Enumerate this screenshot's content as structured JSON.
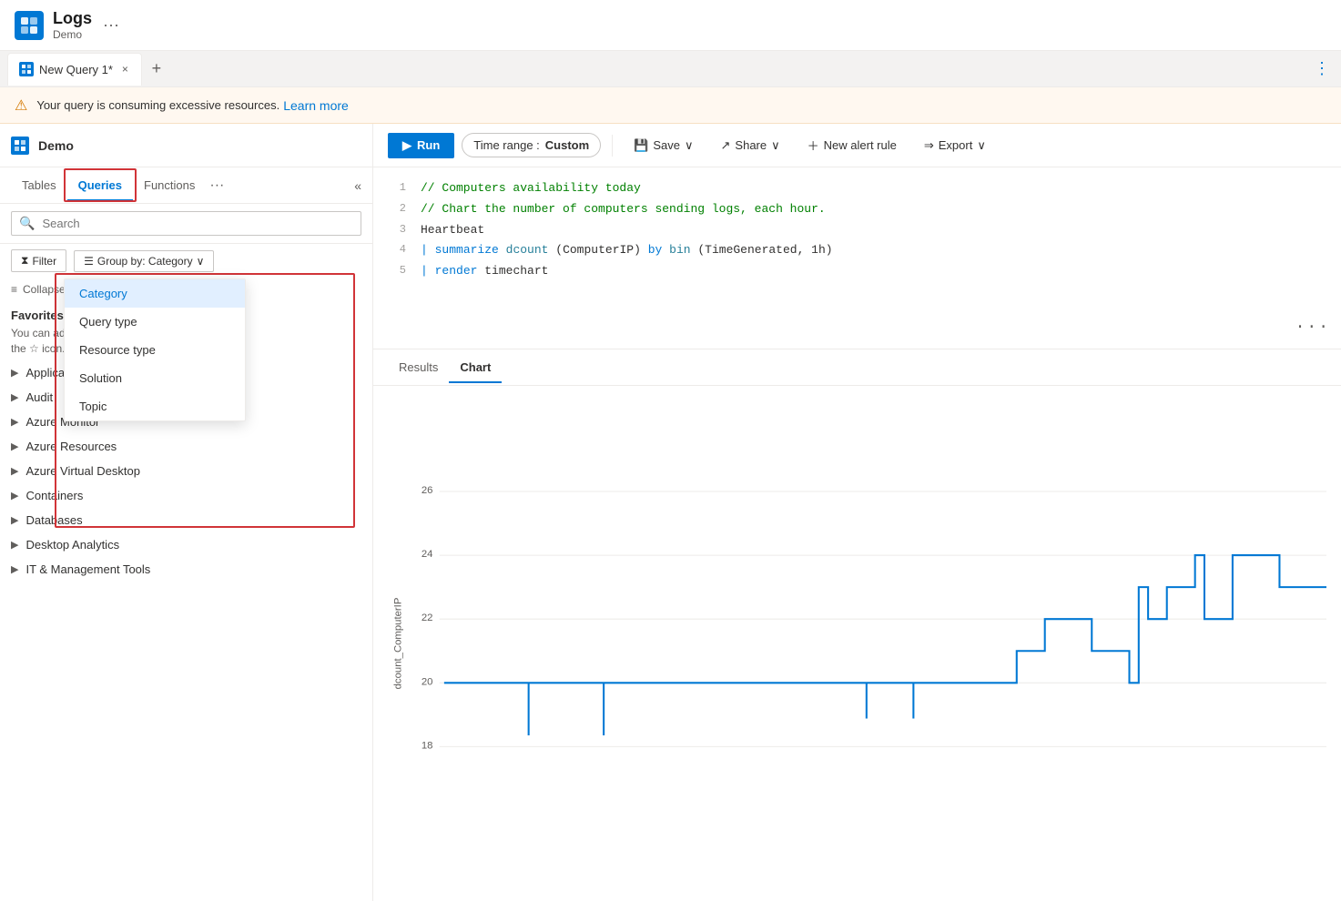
{
  "app": {
    "title": "Logs",
    "subtitle": "Demo",
    "ellipsis": "···"
  },
  "tab_bar": {
    "tab_icon": "logs-icon",
    "tab_label": "New Query 1*",
    "tab_close": "×",
    "tab_add": "+",
    "tab_right": "⋮"
  },
  "warning": {
    "text": "Your query is consuming excessive resources.",
    "link": "Learn more"
  },
  "sidebar": {
    "logo_label": "Demo",
    "tabs": [
      {
        "label": "Tables",
        "active": false
      },
      {
        "label": "Queries",
        "active": true
      },
      {
        "label": "Functions",
        "active": false
      }
    ],
    "tab_more": "···",
    "tab_collapse": "«",
    "search_placeholder": "Search",
    "filter_label": "Filter",
    "group_by_label": "Group by: Category",
    "collapse_label": "Collapse all",
    "favorites_title": "Favorites",
    "favorites_desc": "You can add any query by clicking on the ☆ ico",
    "categories": [
      {
        "label": "Application"
      },
      {
        "label": "Audit"
      },
      {
        "label": "Azure Monitor"
      },
      {
        "label": "Azure Resources"
      },
      {
        "label": "Azure Virtual Desktop"
      },
      {
        "label": "Containers"
      },
      {
        "label": "Databases"
      },
      {
        "label": "Desktop Analytics"
      },
      {
        "label": "IT & Management Tools"
      }
    ],
    "dropdown_items": [
      {
        "label": "Category",
        "selected": true
      },
      {
        "label": "Query type",
        "selected": false
      },
      {
        "label": "Resource type",
        "selected": false
      },
      {
        "label": "Solution",
        "selected": false
      },
      {
        "label": "Topic",
        "selected": false
      }
    ]
  },
  "toolbar": {
    "run_label": "Run",
    "time_range_label": "Time range :",
    "time_range_value": "Custom",
    "save_label": "Save",
    "share_label": "Share",
    "new_alert_label": "New alert rule",
    "export_label": "Export"
  },
  "code_editor": {
    "lines": [
      {
        "num": "1",
        "content": "// Computers availability today",
        "type": "comment"
      },
      {
        "num": "2",
        "content": "// Chart the number of computers sending logs, each hour.",
        "type": "comment"
      },
      {
        "num": "3",
        "content": "Heartbeat",
        "type": "plain"
      },
      {
        "num": "4",
        "content": "| summarize dcount(ComputerIP) by bin(TimeGenerated, 1h)",
        "type": "code"
      },
      {
        "num": "5",
        "content": "| render timechart",
        "type": "code"
      }
    ],
    "more_indicator": "···"
  },
  "result_tabs": [
    {
      "label": "Results",
      "active": false
    },
    {
      "label": "Chart",
      "active": true
    }
  ],
  "chart": {
    "y_label": "dcount_ComputerIP",
    "y_ticks": [
      "26",
      "24",
      "22",
      "20",
      "18"
    ],
    "accent_color": "#0078d4"
  }
}
